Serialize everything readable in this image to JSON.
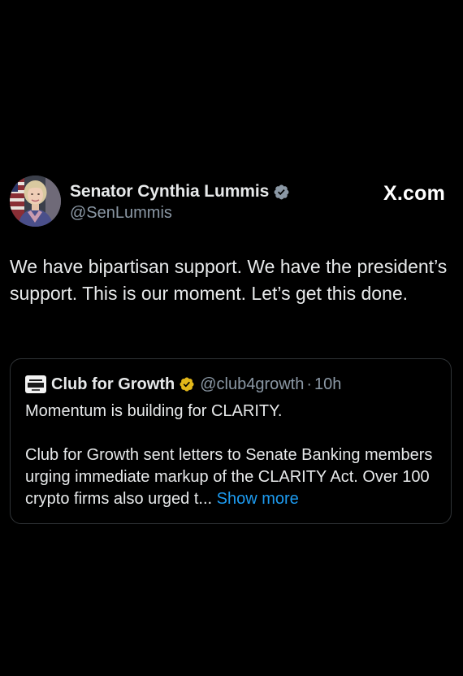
{
  "tweet": {
    "author": {
      "display_name": "Senator Cynthia Lummis",
      "handle": "@SenLummis",
      "verified_icon": "verified-badge-icon",
      "avatar": "profile-photo"
    },
    "site_logo": "X.com",
    "text": "We have bipartisan support. We have the president’s support. This is our moment. Let’s get this done.",
    "quoted_tweet": {
      "avatar": "club-for-growth-logo",
      "display_name": "Club for Growth",
      "verified_icon": "verified-gold-badge-icon",
      "handle": "@club4growth",
      "separator": "·",
      "time": "10h",
      "paragraph1": "Momentum is building for CLARITY.",
      "paragraph2": "Club for Growth sent letters to Senate Banking members urging immediate markup of the CLARITY Act. Over 100 crypto firms also urged t...",
      "show_more_label": "Show more"
    }
  },
  "colors": {
    "background": "#000000",
    "primary_text": "#e7e9ea",
    "secondary_text": "#8b98a5",
    "link": "#1d9bf0",
    "verified_gray": "#8b98a5",
    "verified_gold": "#e2b719",
    "card_border": "#2f3336"
  }
}
